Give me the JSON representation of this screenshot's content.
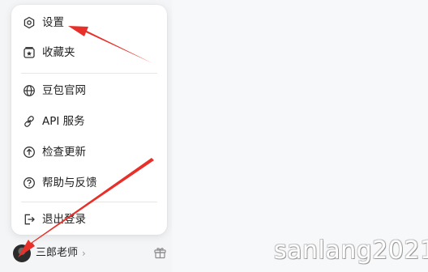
{
  "menu": {
    "items": [
      {
        "label": "设置",
        "icon": "gear-icon"
      },
      {
        "label": "收藏夹",
        "icon": "bookmark-icon"
      },
      {
        "label": "豆包官网",
        "icon": "globe-icon"
      },
      {
        "label": "API 服务",
        "icon": "link-icon"
      },
      {
        "label": "检查更新",
        "icon": "arrow-up-circle-icon"
      },
      {
        "label": "帮助与反馈",
        "icon": "question-circle-icon"
      },
      {
        "label": "退出登录",
        "icon": "logout-icon"
      }
    ]
  },
  "user": {
    "name": "三郎老师",
    "chevron": "›",
    "gift_icon": "gift-icon"
  },
  "watermark": "sanlang2021",
  "colors": {
    "annotation_arrow": "#e8302a",
    "menu_background": "#ffffff",
    "page_background": "#f3f4f6"
  }
}
